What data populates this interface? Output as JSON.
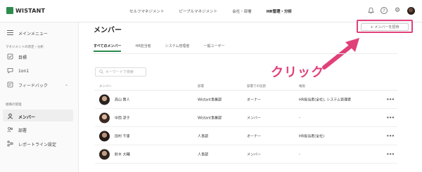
{
  "brand": {
    "logo_text": "WISTANT",
    "logo_color": "#2e8b4e"
  },
  "nav": [
    "セルフマネジメント",
    "ピープルマネジメント",
    "会社・部署",
    "HR管理・分析"
  ],
  "top_icons": [
    "bell-icon",
    "help-icon",
    "gear-icon",
    "avatar"
  ],
  "sidebar": {
    "menu_label": "メインメニュー",
    "section1": "マネジメントの改定・分析",
    "items": [
      {
        "label": "目標",
        "icon": "target-icon"
      },
      {
        "label": "1on1",
        "icon": "chat-icon"
      },
      {
        "label": "フィードバック",
        "icon": "feedback-icon",
        "chevron": "⌄"
      }
    ],
    "section2": "組織の管理",
    "items2": [
      {
        "label": "メンバー",
        "icon": "member-icon",
        "active": true
      },
      {
        "label": "部署",
        "icon": "department-icon"
      },
      {
        "label": "レポートライン設定",
        "icon": "reportline-icon"
      }
    ]
  },
  "main": {
    "title": "メンバー",
    "add_button": "+ メンバーを招待",
    "tabs": [
      "すべてのメンバー",
      "HR担当者",
      "システム管理者",
      "一般ユーザー"
    ],
    "search_placeholder": "キーワードで検索",
    "annotation": "クリック",
    "accent_color": "#e0407a"
  },
  "table": {
    "headers": [
      "メンバー",
      "部署",
      "部署での役割",
      "権限"
    ],
    "rows": [
      {
        "name": "高山 賢人",
        "dept": "Wistant事業部",
        "role": "オーナー",
        "auth": "HR担当者(全社), システム管理者"
      },
      {
        "name": "中西 涼子",
        "dept": "Wistant事業部",
        "role": "メンバー",
        "auth": "-"
      },
      {
        "name": "田村 千里",
        "dept": "人事部",
        "role": "オーナー",
        "auth": "HR担当者(全社)"
      },
      {
        "name": "鈴木 大輔",
        "dept": "人事部",
        "role": "メンバー",
        "auth": "-"
      }
    ],
    "more_label": "•••"
  }
}
